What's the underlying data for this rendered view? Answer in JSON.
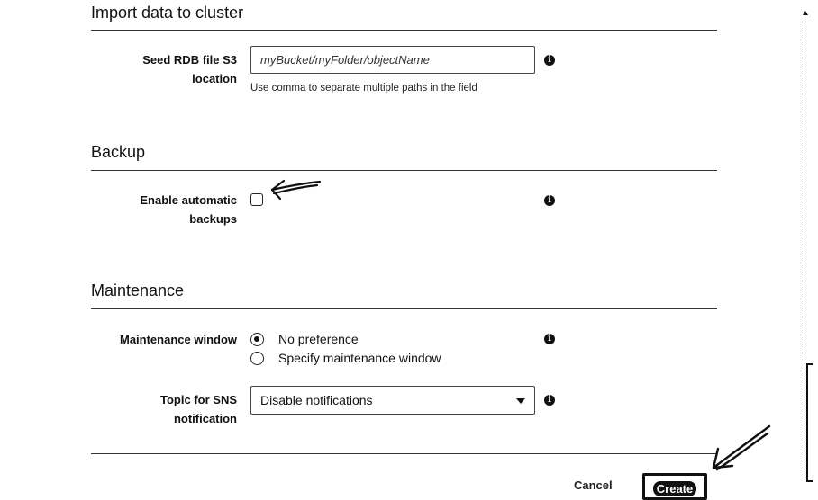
{
  "import_section": {
    "title": "Import data to cluster",
    "seed_label_line1": "Seed RDB file S3",
    "seed_label_line2": "location",
    "seed_placeholder": "myBucket/myFolder/objectName",
    "seed_hint": "Use comma to separate multiple paths in the field"
  },
  "backup_section": {
    "title": "Backup",
    "enable_label_line1": "Enable automatic",
    "enable_label_line2": "backups",
    "enable_checked": false
  },
  "maintenance_section": {
    "title": "Maintenance",
    "window_label": "Maintenance window",
    "options": [
      "No preference",
      "Specify maintenance window"
    ],
    "selected_option": "No preference",
    "sns_label_line1": "Topic for SNS",
    "sns_label_line2": "notification",
    "sns_selected": "Disable notifications"
  },
  "footer": {
    "cancel_label": "Cancel",
    "create_label": "Create"
  },
  "icons": {
    "info": "info-icon",
    "dropdown": "chevron-down-icon"
  }
}
